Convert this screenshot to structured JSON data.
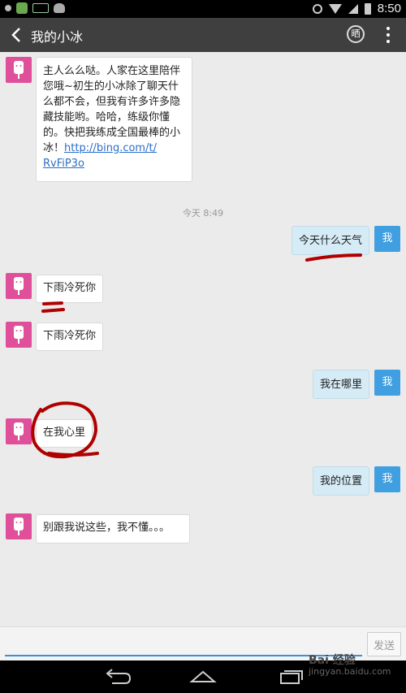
{
  "status_bar": {
    "time": "8:50",
    "icons": [
      "notification-dot-icon",
      "app-icon",
      "battery-app-icon",
      "android-icon",
      "alarm-icon",
      "wifi-icon",
      "signal-icon",
      "battery-icon"
    ]
  },
  "header": {
    "title": "我的小冰",
    "share_label": "晒",
    "icons": [
      "back-arrow-icon",
      "more-menu-icon"
    ]
  },
  "messages": {
    "m1_line1": "主人么么哒。人家在这里陪伴",
    "m1_line2": "您哦~初生的小冰除了聊天什",
    "m1_line3": "么都不会，但我有许多许多隐",
    "m1_line4": "藏技能哟。哈哈，练级你懂",
    "m1_line5": "的。快把我练成全国最棒的小",
    "m1_line6_text": "冰！",
    "m1_link1": "http://bing.com/t/",
    "m1_link2": "RvFiP3o",
    "timestamp": "今天 8:49",
    "m2": "今天什么天气",
    "m3": "下雨冷死你",
    "m4": "下雨冷死你",
    "m5": "我在哪里",
    "m6": "在我心里",
    "m7": "我的位置",
    "m8": "别跟我说这些，我不懂。。。"
  },
  "me_label": "我",
  "input": {
    "value": "",
    "send_label": "发送"
  },
  "watermark": {
    "brand": "Bai 经验",
    "url": "jingyan.baidu.com"
  },
  "colors": {
    "bot_avatar": "#e04f9a",
    "me_avatar": "#3f9fe0",
    "annotation": "#b00000"
  }
}
